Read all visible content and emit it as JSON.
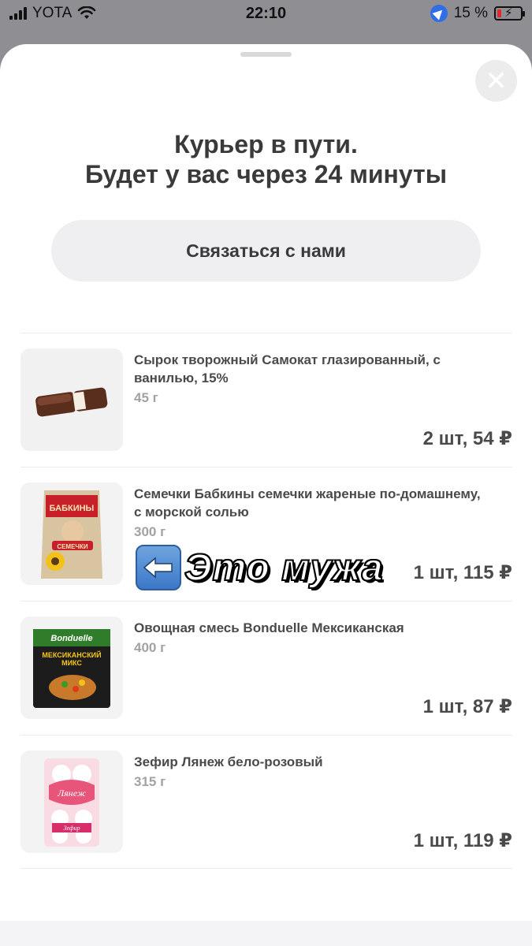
{
  "status_bar": {
    "carrier": "YOTA",
    "time": "22:10",
    "battery_percent": "15 %"
  },
  "sheet": {
    "title_line1": "Курьер в пути.",
    "title_line2": "Будет у вас через 24 минуты",
    "contact_label": "Связаться с нами"
  },
  "items": [
    {
      "name": "Сырок творожный Самокат глазированный, с ванилью, 15%",
      "weight": "45 г",
      "price": "2 шт, 54 ₽",
      "image": "glazed-curd-bar"
    },
    {
      "name": "Семечки Бабкины семечки жареные по-домашнему, с морской солью",
      "weight": "300 г",
      "price": "1 шт, 115 ₽",
      "image": "sunflower-seeds-pack",
      "pack_text": {
        "line1": "БАБКИНЫ",
        "line2": "СЕМЕЧКИ"
      }
    },
    {
      "name": "Овощная смесь Bonduelle Мексиканская",
      "weight": "400 г",
      "price": "1 шт, 87 ₽",
      "image": "vegetable-mix-pack",
      "pack_text": {
        "brand": "Bonduelle",
        "line1": "МЕКСИКАНСКИЙ",
        "line2": "МИКС"
      }
    },
    {
      "name": "Зефир Лянеж бело-розовый",
      "weight": "315 г",
      "price": "1 шт, 119 ₽",
      "image": "marshmallow-box",
      "pack_text": {
        "brand": "Лянеж",
        "subtitle": "Зефир"
      }
    }
  ],
  "overlay": {
    "text": "Это мужа",
    "icon": "left-arrow-emoji"
  },
  "colors": {
    "accent_red": "#e0282e",
    "location_blue": "#2f6ee8",
    "text_dark": "#3a3a3a",
    "text_muted": "#a2a2a2"
  }
}
